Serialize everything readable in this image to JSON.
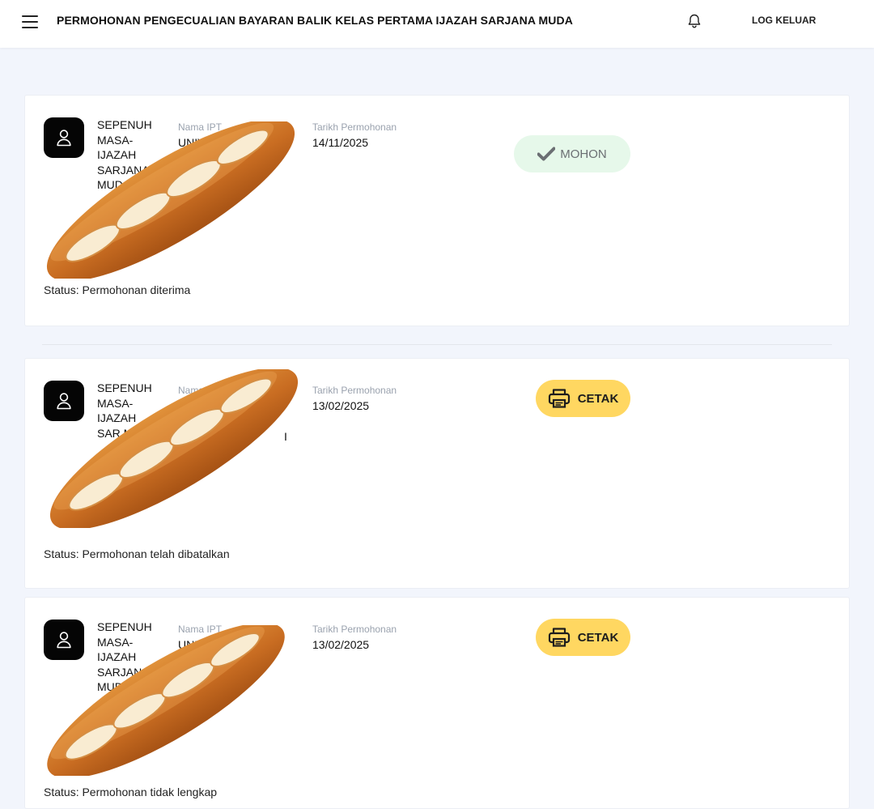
{
  "header": {
    "title": "PERMOHONAN PENGECUALIAN BAYARAN BALIK KELAS PERTAMA IJAZAH SARJANA MUDA",
    "menu_icon": "hamburger-menu-icon",
    "notification_icon": "bell-icon",
    "logout_label": "LOG KELUAR"
  },
  "labels": {
    "institution": "Nama IPT",
    "date": "Tarikh Permohonan"
  },
  "applications": [
    {
      "category": "SEPENUH MASA- IJAZAH SARJANA MUDA S",
      "institution": "UNIV",
      "date": "14/11/2025",
      "action_label": "MOHON",
      "action_icon": "check-icon",
      "status": "Status: Permohonan diterima"
    },
    {
      "category": "SEPENUH MASA- IJAZAH SAR M",
      "institution": "I",
      "date": "13/02/2025",
      "action_label": "CETAK",
      "action_icon": "printer-icon",
      "status": "Status: Permohonan telah dibatalkan"
    },
    {
      "category": "SEPENUH MASA- IJAZAH SARJAN MUD",
      "institution": "UNIV",
      "date": "13/02/2025",
      "action_label": "CETAK",
      "action_icon": "printer-icon",
      "status": "Status: Permohonan tidak lengkap"
    }
  ],
  "colors": {
    "page_background": "#f2f5fc",
    "mohon_button": "#e6f8ea",
    "cetak_button": "#ffd761",
    "avatar": "#050505",
    "overlay_bread": "#c96d22"
  },
  "overlay_icon": "baguette-bread-icon"
}
